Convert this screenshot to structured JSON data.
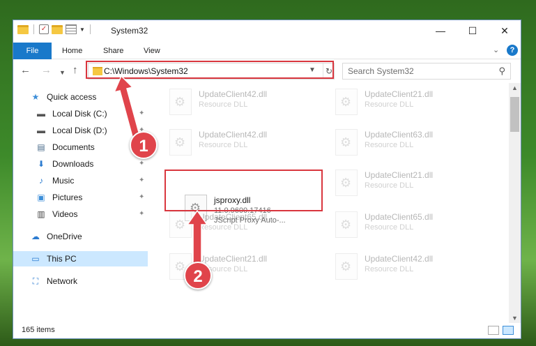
{
  "window": {
    "title": "System32",
    "controls": {
      "minimize": "—",
      "maximize": "☐",
      "close": "✕"
    }
  },
  "ribbon": {
    "file_tab": "File",
    "tabs": [
      "Home",
      "Share",
      "View"
    ]
  },
  "address_bar": {
    "path": "C:\\Windows\\System32"
  },
  "search": {
    "placeholder": "Search System32"
  },
  "sidebar": {
    "quick_access": "Quick access",
    "items": [
      {
        "label": "Local Disk (C:)",
        "icon": "drive-icon",
        "pinned": true
      },
      {
        "label": "Local Disk (D:)",
        "icon": "drive-icon",
        "pinned": true
      },
      {
        "label": "Documents",
        "icon": "documents-icon",
        "pinned": true
      },
      {
        "label": "Downloads",
        "icon": "downloads-icon",
        "pinned": true
      },
      {
        "label": "Music",
        "icon": "music-icon",
        "pinned": true
      },
      {
        "label": "Pictures",
        "icon": "pictures-icon",
        "pinned": true
      },
      {
        "label": "Videos",
        "icon": "videos-icon",
        "pinned": true
      }
    ],
    "onedrive": "OneDrive",
    "this_pc": "This PC",
    "network": "Network"
  },
  "files": [
    {
      "name": "UpdateClient42.dll",
      "desc": "Resource DLL"
    },
    {
      "name": "UpdateClient21.dll",
      "desc": "Resource DLL"
    },
    {
      "name": "UpdateClient42.dll",
      "desc": "Resource DLL"
    },
    {
      "name": "UpdateClient63.dll",
      "desc": "Resource DLL"
    },
    {
      "name": "jsproxy.dll",
      "desc": "11.0.9600.17416",
      "desc2": "JScript Proxy Auto-..."
    },
    {
      "name": "UpdateClient21.dll",
      "desc": "Resource DLL"
    },
    {
      "name": "UpdateClient65.dll",
      "desc": "Resource DLL"
    },
    {
      "name": "UpdateClient65.dll",
      "desc": "Resource DLL"
    },
    {
      "name": "UpdateClient21.dll",
      "desc": "Resource DLL"
    },
    {
      "name": "UpdateClient42.dll",
      "desc": "Resource DLL"
    }
  ],
  "status": {
    "item_count": "165 items"
  },
  "annotations": {
    "step1": "1",
    "step2": "2",
    "highlight_color": "#d9363e"
  }
}
